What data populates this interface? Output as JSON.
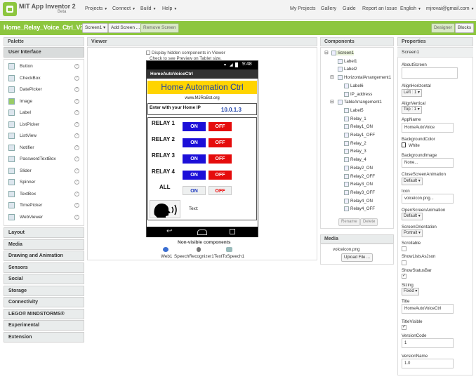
{
  "app": {
    "name": "MIT App Inventor 2",
    "edition": "Beta"
  },
  "topmenu": {
    "projects": "Projects",
    "connect": "Connect",
    "build": "Build",
    "help": "Help",
    "my_projects": "My Projects",
    "gallery": "Gallery",
    "guide": "Guide",
    "report": "Report an Issue",
    "language": "English",
    "account": "mjrovai@gmail.com"
  },
  "toolbar": {
    "project_name": "Home_Relay_Voice_Ctrl_V2",
    "screen_select": "Screen1",
    "add_screen": "Add Screen ...",
    "remove_screen": "Remove Screen",
    "designer": "Designer",
    "blocks": "Blocks"
  },
  "palette": {
    "title": "Palette",
    "group": "User Interface",
    "items": [
      {
        "label": "Button",
        "icon": "button-icon"
      },
      {
        "label": "CheckBox",
        "icon": "checkbox-icon"
      },
      {
        "label": "DatePicker",
        "icon": "datepicker-icon"
      },
      {
        "label": "Image",
        "icon": "image-icon"
      },
      {
        "label": "Label",
        "icon": "label-icon"
      },
      {
        "label": "ListPicker",
        "icon": "listpicker-icon"
      },
      {
        "label": "ListView",
        "icon": "listview-icon"
      },
      {
        "label": "Notifier",
        "icon": "notifier-icon"
      },
      {
        "label": "PasswordTextBox",
        "icon": "password-icon"
      },
      {
        "label": "Slider",
        "icon": "slider-icon"
      },
      {
        "label": "Spinner",
        "icon": "spinner-icon"
      },
      {
        "label": "TextBox",
        "icon": "textbox-icon"
      },
      {
        "label": "TimePicker",
        "icon": "timepicker-icon"
      },
      {
        "label": "WebViewer",
        "icon": "webviewer-icon"
      }
    ],
    "help": "?",
    "categories": [
      "Layout",
      "Media",
      "Drawing and Animation",
      "Sensors",
      "Social",
      "Storage",
      "Connectivity",
      "LEGO® MINDSTORMS®",
      "Experimental",
      "Extension"
    ]
  },
  "viewer": {
    "title": "Viewer",
    "hidden_toggle": "Display hidden components in Viewer",
    "tablet_note": "Check to see Preview on Tablet size.",
    "phone": {
      "clock": "9:48",
      "title": "HomeAutoVoiceCtrl",
      "header": "Home Automation Ctrl",
      "url": "www.MJRoBot.org",
      "ip_label": "Enter with your Home IP",
      "ip_value": "10.0.1.3",
      "relays": [
        {
          "label": "RELAY 1",
          "on": "ON",
          "off": "OFF"
        },
        {
          "label": "RELAY 2",
          "on": "ON",
          "off": "OFF"
        },
        {
          "label": "RELAY 3",
          "on": "ON",
          "off": "OFF"
        },
        {
          "label": "RELAY 4",
          "on": "ON",
          "off": "OFF"
        },
        {
          "label": "ALL",
          "on": "ON",
          "off": "OFF"
        }
      ],
      "text_label": "Text:"
    },
    "nonvisible_title": "Non-visible components",
    "nonvisible": [
      "Web1",
      "SpeechRecognizer1",
      "TextToSpeech1"
    ]
  },
  "components": {
    "title": "Components",
    "tree": [
      {
        "label": "Screen1",
        "level": 0,
        "expand": "⊟"
      },
      {
        "label": "Label1",
        "level": 1
      },
      {
        "label": "Label2",
        "level": 1
      },
      {
        "label": "HorizontalArrangement1",
        "level": 1,
        "expand": "⊟"
      },
      {
        "label": "Label6",
        "level": 2
      },
      {
        "label": "IP_address",
        "level": 2
      },
      {
        "label": "TableArrangement1",
        "level": 1,
        "expand": "⊟"
      },
      {
        "label": "Label5",
        "level": 2
      },
      {
        "label": "Relay_1",
        "level": 2
      },
      {
        "label": "Relay1_ON",
        "level": 2
      },
      {
        "label": "Relay1_OFF",
        "level": 2
      },
      {
        "label": "Relay_2",
        "level": 2
      },
      {
        "label": "Relay_3",
        "level": 2
      },
      {
        "label": "Relay_4",
        "level": 2
      },
      {
        "label": "Relay2_ON",
        "level": 2
      },
      {
        "label": "Relay2_OFF",
        "level": 2
      },
      {
        "label": "Relay3_ON",
        "level": 2
      },
      {
        "label": "Relay3_OFF",
        "level": 2
      },
      {
        "label": "Relay4_ON",
        "level": 2
      },
      {
        "label": "Relay4_OFF",
        "level": 2
      }
    ],
    "rename": "Rename",
    "delete": "Delete"
  },
  "media": {
    "title": "Media",
    "file": "voiceicon.png",
    "upload": "Upload File ..."
  },
  "properties": {
    "title": "Properties",
    "component": "Screen1",
    "about_label": "AboutScreen",
    "align_h_label": "AlignHorizontal",
    "align_h_value": "Left : 1",
    "align_v_label": "AlignVertical",
    "align_v_value": "Top : 1",
    "appname_label": "AppName",
    "appname_value": "HomeAutoVoice",
    "bgcolor_label": "BackgroundColor",
    "bgcolor_value": "White",
    "bgimage_label": "BackgroundImage",
    "bgimage_value": "None...",
    "close_anim_label": "CloseScreenAnimation",
    "close_anim_value": "Default",
    "icon_label": "Icon",
    "icon_value": "voiceicon.png...",
    "open_anim_label": "OpenScreenAnimation",
    "open_anim_value": "Default",
    "orientation_label": "ScreenOrientation",
    "orientation_value": "Portrait",
    "scrollable_label": "Scrollable",
    "showlists_label": "ShowListsAsJson",
    "statusbar_label": "ShowStatusBar",
    "sizing_label": "Sizing",
    "sizing_value": "Fixed",
    "title_label": "Title",
    "title_value": "HomeAutoVoiceCtrl",
    "titlevisible_label": "TitleVisible",
    "versioncode_label": "VersionCode",
    "versioncode_value": "1",
    "versionname_label": "VersionName",
    "versionname_value": "1.0"
  },
  "colors": {
    "brand_green": "#8dc63f",
    "on_blue": "#1c0fd8",
    "off_red": "#e50c0c",
    "header_yellow": "#ffd400"
  }
}
